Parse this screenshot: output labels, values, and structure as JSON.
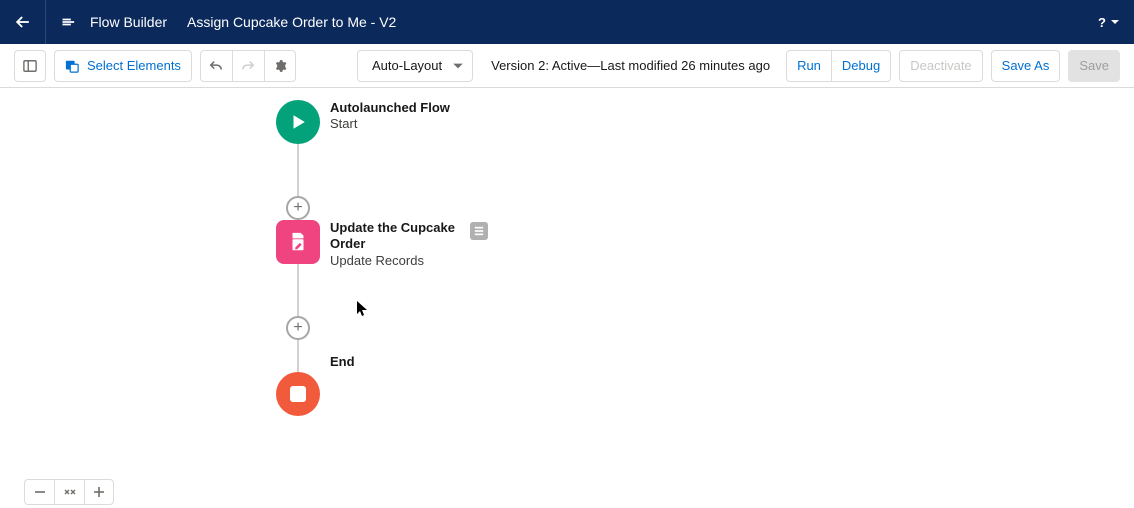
{
  "header": {
    "app_name": "Flow Builder",
    "flow_title": "Assign Cupcake Order to Me - V2",
    "help_label": "?"
  },
  "toolbar": {
    "select_elements_label": "Select Elements",
    "layout_label": "Auto-Layout",
    "status_text": "Version 2: Active—Last modified 26 minutes ago",
    "run_label": "Run",
    "debug_label": "Debug",
    "deactivate_label": "Deactivate",
    "save_as_label": "Save As",
    "save_label": "Save"
  },
  "flow": {
    "start": {
      "title": "Autolaunched Flow",
      "subtitle": "Start"
    },
    "update": {
      "title": "Update the Cupcake Order",
      "subtitle": "Update Records"
    },
    "end": {
      "title": "End"
    }
  }
}
